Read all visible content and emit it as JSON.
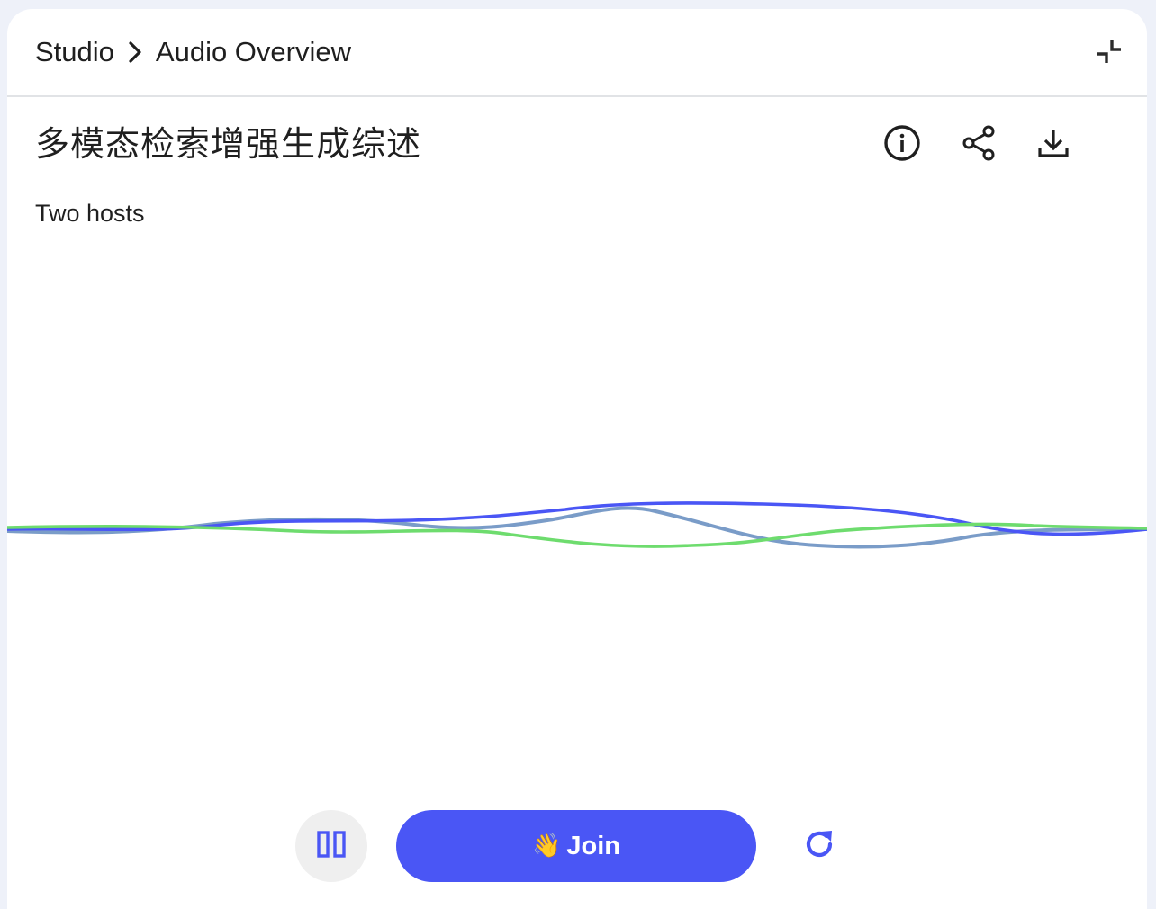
{
  "breadcrumb": {
    "root": "Studio",
    "current": "Audio Overview"
  },
  "icons": {
    "separator": "chevron-right-icon",
    "collapse": "collapse-icon",
    "info": "info-icon",
    "share": "share-icon",
    "download": "download-icon",
    "pause": "pause-icon",
    "replay": "replay-icon"
  },
  "overview": {
    "title": "多模态检索增强生成综述",
    "subtitle": "Two hosts"
  },
  "controls": {
    "join_emoji": "👋",
    "join_label": "Join"
  },
  "colors": {
    "accent": "#4a56f5",
    "wave_blue": "#4a56f5",
    "wave_steel": "#7a9cc8",
    "wave_green": "#6edc6e"
  }
}
